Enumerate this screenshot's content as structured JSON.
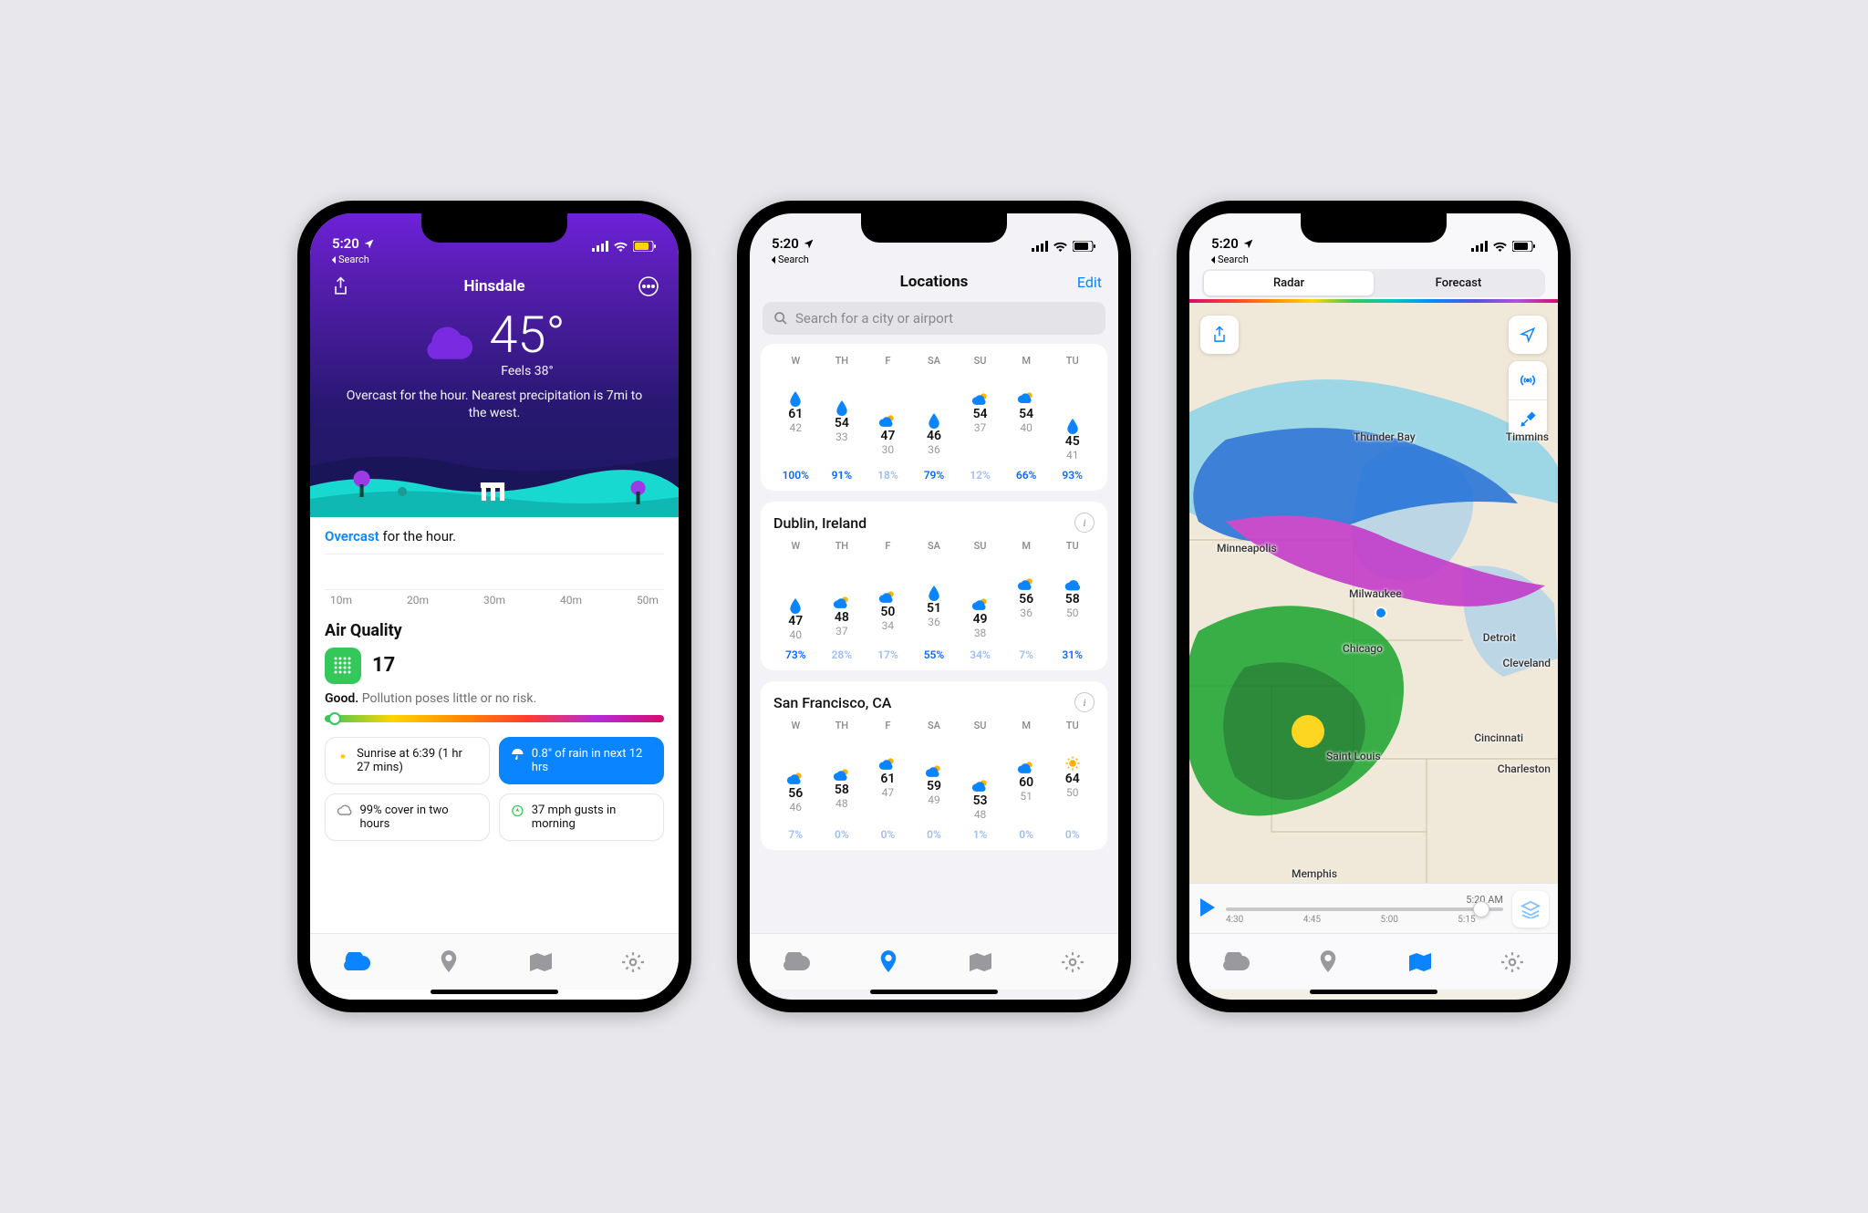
{
  "status": {
    "time": "5:20",
    "back": "Search"
  },
  "phone1": {
    "title": "Hinsdale",
    "temp": "45°",
    "feels": "Feels 38°",
    "desc": "Overcast for the hour. Nearest precipitation is 7mi to the west.",
    "summary_accent": "Overcast",
    "summary_rest": " for the hour.",
    "axis": [
      "10m",
      "20m",
      "30m",
      "40m",
      "50m"
    ],
    "aq": {
      "title": "Air Quality",
      "value": "17",
      "label": "Good.",
      "text": "Pollution poses little or no risk."
    },
    "tiles": {
      "sunrise": "Sunrise at 6:39 (1 hr 27 mins)",
      "rain": "0.8\" of rain in next 12 hrs",
      "clouds": "99% cover in two hours",
      "wind": "37 mph gusts in morning"
    }
  },
  "phone2": {
    "title": "Locations",
    "edit": "Edit",
    "search_placeholder": "Search for a city or airport",
    "day_labels": [
      "W",
      "TH",
      "F",
      "SA",
      "SU",
      "M",
      "TU"
    ],
    "loc0": {
      "d0": {
        "hi": "61",
        "lo": "42",
        "pct": "100%",
        "pc": "hi",
        "icon": "drop"
      },
      "d1": {
        "hi": "54",
        "lo": "33",
        "pct": "91%",
        "pc": "hi",
        "icon": "drop"
      },
      "d2": {
        "hi": "47",
        "lo": "30",
        "pct": "18%",
        "pc": "lo",
        "icon": "pc"
      },
      "d3": {
        "hi": "46",
        "lo": "36",
        "pct": "79%",
        "pc": "hi",
        "icon": "drop"
      },
      "d4": {
        "hi": "54",
        "lo": "37",
        "pct": "12%",
        "pc": "lo",
        "icon": "pc"
      },
      "d5": {
        "hi": "54",
        "lo": "40",
        "pct": "66%",
        "pc": "hi",
        "icon": "pcd"
      },
      "d6": {
        "hi": "45",
        "lo": "41",
        "pct": "93%",
        "pc": "hi",
        "icon": "drop"
      }
    },
    "loc1": {
      "name": "Dublin, Ireland",
      "d0": {
        "hi": "47",
        "lo": "40",
        "pct": "73%",
        "pc": "hi",
        "icon": "drop"
      },
      "d1": {
        "hi": "48",
        "lo": "37",
        "pct": "28%",
        "pc": "lo",
        "icon": "pc"
      },
      "d2": {
        "hi": "50",
        "lo": "34",
        "pct": "17%",
        "pc": "lo",
        "icon": "pc"
      },
      "d3": {
        "hi": "51",
        "lo": "36",
        "pct": "55%",
        "pc": "hi",
        "icon": "drop"
      },
      "d4": {
        "hi": "49",
        "lo": "38",
        "pct": "34%",
        "pc": "lo",
        "icon": "pc"
      },
      "d5": {
        "hi": "56",
        "lo": "36",
        "pct": "7%",
        "pc": "lo",
        "icon": "pc"
      },
      "d6": {
        "hi": "58",
        "lo": "50",
        "pct": "31%",
        "pc": "hi",
        "icon": "cloud"
      }
    },
    "loc2": {
      "name": "San Francisco, CA",
      "d0": {
        "hi": "56",
        "lo": "46",
        "pct": "7%",
        "pc": "lo",
        "icon": "pc"
      },
      "d1": {
        "hi": "58",
        "lo": "48",
        "pct": "0%",
        "pc": "lo",
        "icon": "pc"
      },
      "d2": {
        "hi": "61",
        "lo": "47",
        "pct": "0%",
        "pc": "lo",
        "icon": "pc"
      },
      "d3": {
        "hi": "59",
        "lo": "49",
        "pct": "0%",
        "pc": "lo",
        "icon": "pc"
      },
      "d4": {
        "hi": "53",
        "lo": "48",
        "pct": "1%",
        "pc": "lo",
        "icon": "pc"
      },
      "d5": {
        "hi": "60",
        "lo": "51",
        "pct": "0%",
        "pc": "lo",
        "icon": "pc"
      },
      "d6": {
        "hi": "64",
        "lo": "50",
        "pct": "0%",
        "pc": "lo",
        "icon": "sun"
      }
    }
  },
  "phone3": {
    "seg": {
      "radar": "Radar",
      "forecast": "Forecast"
    },
    "cities": [
      "Thunder Bay",
      "Timmins",
      "Minneapolis",
      "Milwaukee",
      "Chicago",
      "Detroit",
      "Cleveland",
      "Cincinnati",
      "Saint Louis",
      "Charleston",
      "Memphis"
    ],
    "scrubber": {
      "label": "5:20 AM",
      "ticks": [
        "4:30",
        "4:45",
        "5:00",
        "5:15"
      ]
    }
  }
}
